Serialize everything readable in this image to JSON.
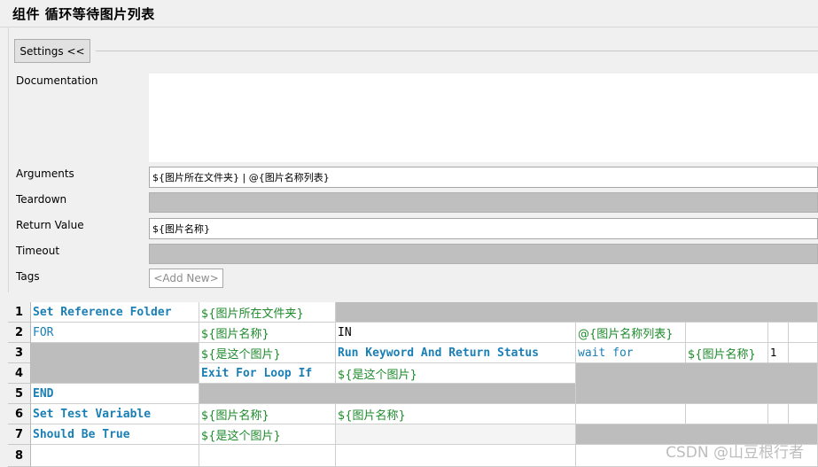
{
  "window": {
    "title": "组件  循环等待图片列表"
  },
  "settings": {
    "toggle_label": "Settings <<"
  },
  "fields": {
    "documentation": {
      "label": "Documentation",
      "value": ""
    },
    "arguments": {
      "label": "Arguments",
      "value": "${图片所在文件夹} | @{图片名称列表}"
    },
    "teardown": {
      "label": "Teardown",
      "value": ""
    },
    "return_value": {
      "label": "Return Value",
      "value": "${图片名称}"
    },
    "timeout": {
      "label": "Timeout",
      "value": ""
    },
    "tags": {
      "label": "Tags",
      "add_new": "<Add New>"
    }
  },
  "grid": {
    "row_numbers": [
      "1",
      "2",
      "3",
      "4",
      "5",
      "6",
      "7",
      "8"
    ],
    "rows": [
      [
        "Set Reference Folder",
        "${图片所在文件夹}",
        "",
        "",
        "",
        "",
        "",
        ""
      ],
      [
        "FOR",
        "${图片名称}",
        "IN",
        "@{图片名称列表}",
        "",
        "",
        "",
        ""
      ],
      [
        "",
        "${是这个图片}",
        "Run Keyword And Return Status",
        "wait for",
        "${图片名称}",
        "1",
        "",
        ""
      ],
      [
        "",
        "Exit For Loop If",
        "${是这个图片}",
        "",
        "",
        "",
        "",
        ""
      ],
      [
        "END",
        "",
        "",
        "",
        "",
        "",
        "",
        ""
      ],
      [
        "Set Test Variable",
        "${图片名称}",
        "${图片名称}",
        "",
        "",
        "",
        "",
        ""
      ],
      [
        "Should Be True",
        "${是这个图片}",
        "",
        "",
        "",
        "",
        "",
        ""
      ],
      [
        "",
        "",
        "",
        "",
        "",
        "",
        "",
        ""
      ]
    ]
  },
  "watermark": "CSDN @山豆根行者"
}
